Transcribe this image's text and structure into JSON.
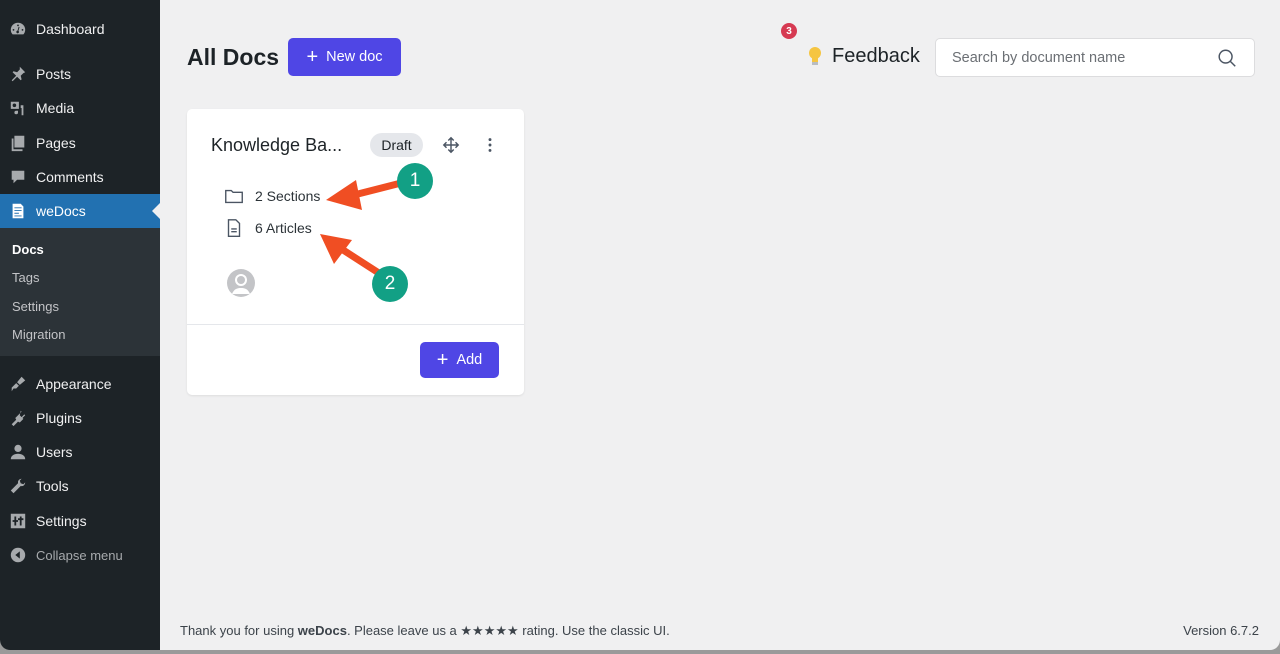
{
  "sidebar": {
    "items": [
      {
        "label": "Dashboard",
        "icon": "dashboard-icon"
      },
      {
        "label": "Posts",
        "icon": "pin-icon"
      },
      {
        "label": "Media",
        "icon": "media-icon"
      },
      {
        "label": "Pages",
        "icon": "pages-icon"
      },
      {
        "label": "Comments",
        "icon": "comment-icon"
      },
      {
        "label": "weDocs",
        "icon": "document-icon",
        "active": true
      },
      {
        "label": "Appearance",
        "icon": "brush-icon"
      },
      {
        "label": "Plugins",
        "icon": "plug-icon"
      },
      {
        "label": "Users",
        "icon": "user-icon"
      },
      {
        "label": "Tools",
        "icon": "wrench-icon"
      },
      {
        "label": "Settings",
        "icon": "sliders-icon"
      }
    ],
    "submenu": [
      {
        "label": "Docs",
        "current": true
      },
      {
        "label": "Tags"
      },
      {
        "label": "Settings"
      },
      {
        "label": "Migration"
      }
    ],
    "collapse_label": "Collapse menu"
  },
  "header": {
    "title": "All Docs",
    "new_doc_label": "New doc",
    "feedback_label": "Feedback",
    "feedback_badge": "3",
    "search_placeholder": "Search by document name"
  },
  "card": {
    "title": "Knowledge Ba...",
    "status": "Draft",
    "sections": "2 Sections",
    "articles": "6 Articles",
    "add_label": "Add"
  },
  "annotations": {
    "marker1": "1",
    "marker2": "2",
    "arrow_color": "#f04e23",
    "marker_color": "#12a085"
  },
  "footer": {
    "prefix": "Thank you for using ",
    "brand": "weDocs",
    "middle": ". Please leave us a ",
    "stars": "★★★★★",
    "suffix": " rating. Use the classic UI.",
    "version": "Version 6.7.2"
  },
  "colors": {
    "accent": "#4f46e5",
    "sidebar_bg": "#1d2327",
    "sidebar_active": "#2271b1",
    "badge": "#d63a52"
  }
}
